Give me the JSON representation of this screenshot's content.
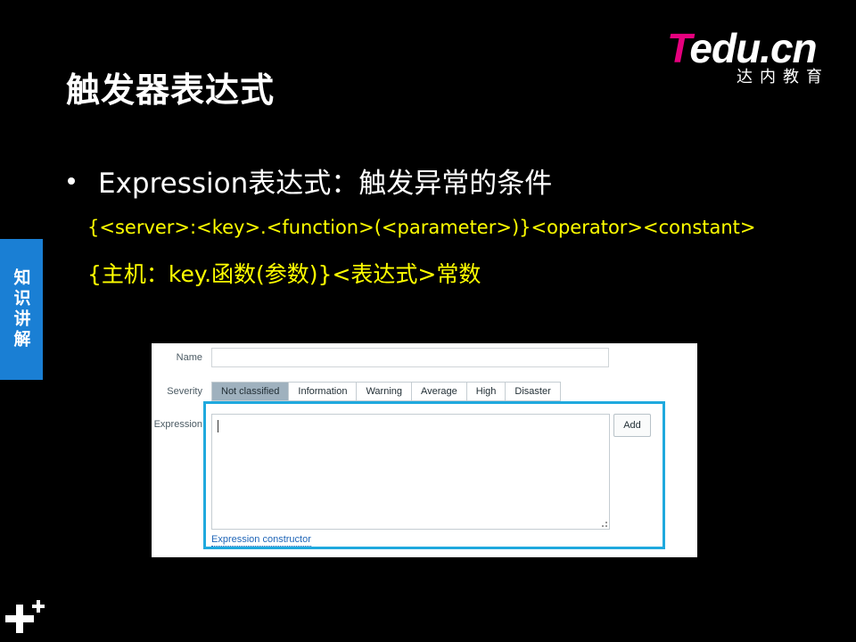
{
  "slide": {
    "title": "触发器表达式",
    "side_tab": "知识讲解",
    "bullet": "Expression表达式：触发异常的条件",
    "expression_syntax": "{<server>:<key>.<function>(<parameter>)}<operator><constant>",
    "expression_cn": "{主机：key.函数(参数)}<表达式>常数"
  },
  "logo": {
    "t": "T",
    "rest": "edu.cn",
    "subtitle": "达内教育"
  },
  "form": {
    "name_label": "Name",
    "severity_label": "Severity",
    "expression_label": "Expression",
    "severity_options": [
      "Not classified",
      "Information",
      "Warning",
      "Average",
      "High",
      "Disaster"
    ],
    "selected_severity": "Not classified",
    "add_label": "Add",
    "constructor_link": "Expression constructor"
  },
  "colors": {
    "background": "#000000",
    "accent_yellow": "#ffff00",
    "side_tab_blue": "#1a7fd4",
    "highlight_border": "#1fa9de",
    "logo_pink": "#e6007e"
  }
}
